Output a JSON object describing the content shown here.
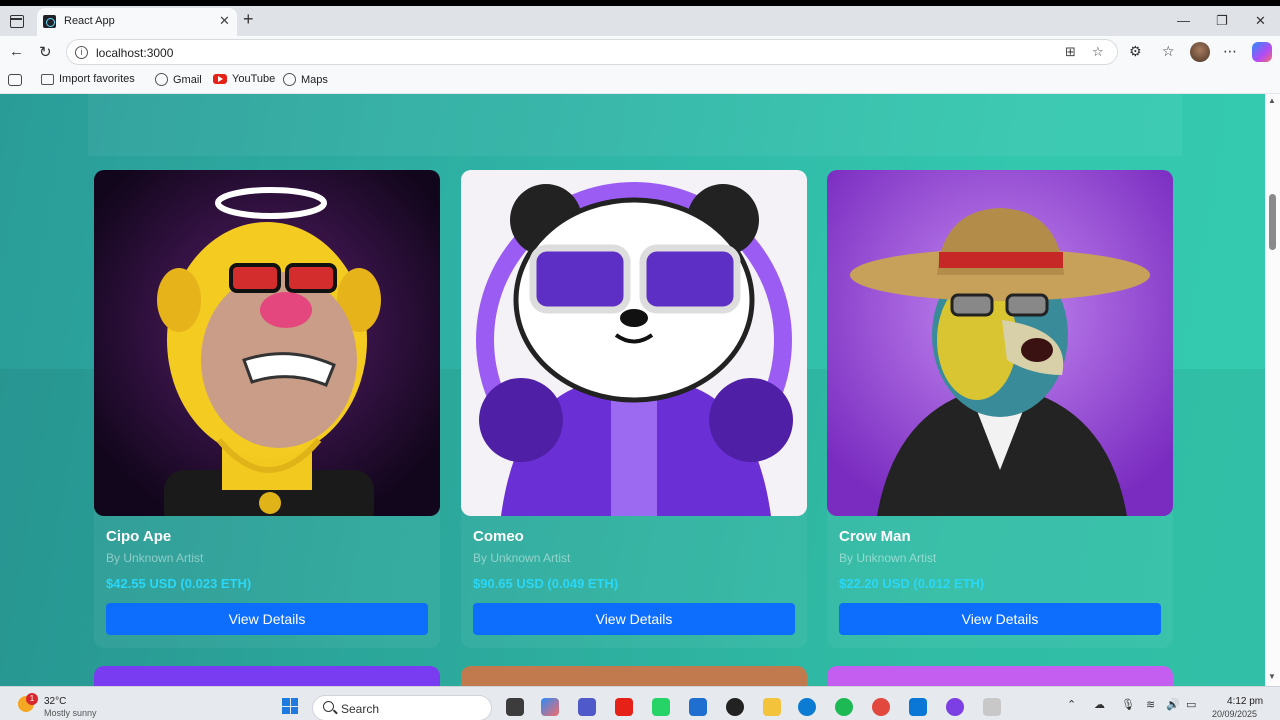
{
  "browser": {
    "tab_title": "React App",
    "url": "localhost:3000",
    "new_tab_symbol": "+",
    "tab_close_symbol": "✕",
    "window_min": "—",
    "window_max": "❐",
    "window_close": "✕",
    "bookmarks": [
      "Import favorites",
      "Gmail",
      "YouTube",
      "Maps"
    ]
  },
  "cards": [
    {
      "name": "Cipo Ape",
      "artist": "By Unknown Artist",
      "price": "$42.55 USD (0.023 ETH)",
      "button": "View Details"
    },
    {
      "name": "Comeo",
      "artist": "By Unknown Artist",
      "price": "$90.65 USD (0.049 ETH)",
      "button": "View Details"
    },
    {
      "name": "Crow Man",
      "artist": "By Unknown Artist",
      "price": "$22.20 USD (0.012 ETH)",
      "button": "View Details"
    }
  ],
  "taskbar": {
    "weather_temp": "32°C",
    "weather_desc": "Mostly sunny",
    "weather_badge": "1",
    "search_placeholder": "Search",
    "time": "4:12 pm",
    "date": "20/09/2025"
  },
  "colors": {
    "page_bg": "#2fb3a5",
    "button": "#0d6efd",
    "price": "#2ad7f7"
  }
}
